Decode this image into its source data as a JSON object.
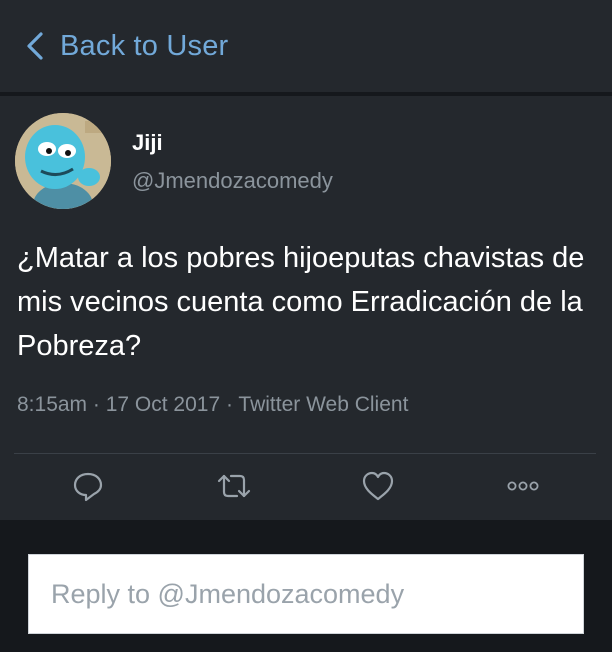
{
  "header": {
    "back_label": "Back to User",
    "back_icon": "chevron-left-icon"
  },
  "tweet": {
    "avatar_icon": "avatar",
    "display_name": "Jiji",
    "handle": "@Jmendozacomedy",
    "text": "¿Matar a los pobres hijoeputas chavistas de mis vecinos cuenta como Erradicación de la Pobreza?",
    "meta": "8:15am · 17 Oct 2017 · Twitter Web Client",
    "actions": [
      {
        "name": "reply",
        "icon": "reply-icon"
      },
      {
        "name": "retweet",
        "icon": "retweet-icon"
      },
      {
        "name": "like",
        "icon": "heart-icon"
      },
      {
        "name": "more",
        "icon": "more-icon"
      }
    ]
  },
  "reply": {
    "placeholder": "Reply to @Jmendozacomedy"
  },
  "colors": {
    "background": "#15181c",
    "card": "#24282d",
    "accent": "#72a9d9",
    "muted": "#8b949c"
  }
}
